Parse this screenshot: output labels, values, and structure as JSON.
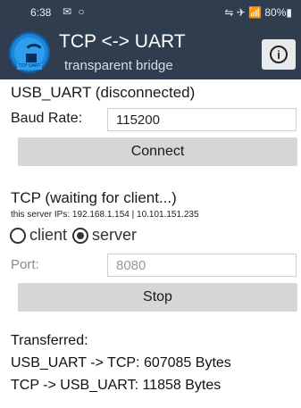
{
  "status_bar": {
    "time": "6:38",
    "left_icons": "✉ ○",
    "right_icons": "⇋ ✈ 📶 80%▮"
  },
  "app_bar": {
    "title": "TCP <-> UART",
    "subtitle": "transparent bridge",
    "logo_tag": "TCP UART",
    "info_icon": "info-icon"
  },
  "uart": {
    "title": "USB_UART (disconnected)",
    "baud_label": "Baud Rate:",
    "baud_value": "115200",
    "connect_label": "Connect"
  },
  "tcp": {
    "title": "TCP (waiting for client...)",
    "server_ips": "this server IPs: 192.168.1.154 | 10.101.151.235",
    "mode_options": [
      "client",
      "server"
    ],
    "mode_selected": "server",
    "port_label": "Port:",
    "port_value": "8080",
    "stop_label": "Stop"
  },
  "stats": {
    "title": "Transferred:",
    "uart_to_tcp": "USB_UART -> TCP:  607085 Bytes",
    "tcp_to_uart": "TCP -> USB_UART:  11858 Bytes"
  }
}
